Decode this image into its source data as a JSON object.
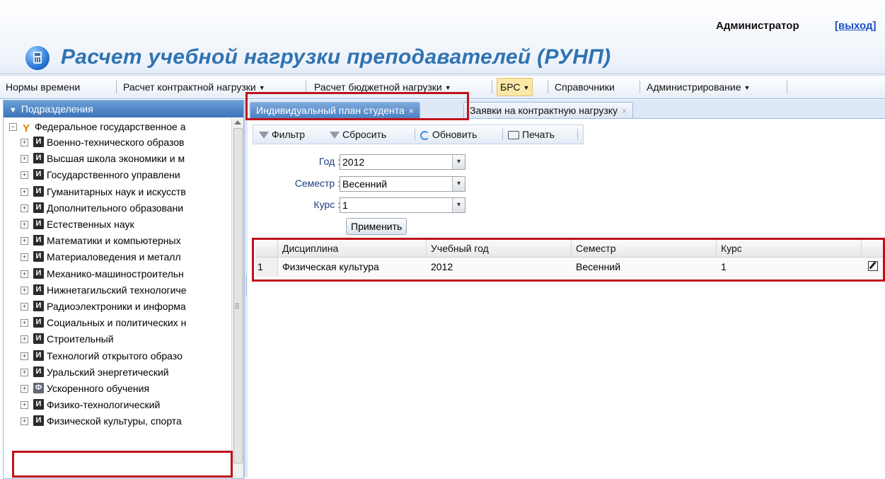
{
  "header": {
    "title": "Расчет учебной нагрузки преподавателей (РУНП)",
    "user": "Администратор",
    "logout": "[выход]"
  },
  "menu": [
    {
      "label": "Нормы времени",
      "has_dropdown": false,
      "active": false
    },
    {
      "label": "Расчет контрактной нагрузки",
      "has_dropdown": true,
      "active": false
    },
    {
      "label": "Расчет бюджетной нагрузки",
      "has_dropdown": true,
      "active": false
    },
    {
      "label": "БРС",
      "has_dropdown": true,
      "active": true
    },
    {
      "label": "Справочники",
      "has_dropdown": false,
      "active": false
    },
    {
      "label": "Администрирование",
      "has_dropdown": true,
      "active": false
    }
  ],
  "left_panel": {
    "title": "Подразделения",
    "tree": {
      "root": "Федеральное государственное а",
      "items": [
        {
          "icon": "И",
          "label": "Военно-технического образов"
        },
        {
          "icon": "И",
          "label": "Высшая школа экономики и м"
        },
        {
          "icon": "И",
          "label": "Государственного управлени"
        },
        {
          "icon": "И",
          "label": "Гуманитарных наук и искусств"
        },
        {
          "icon": "И",
          "label": "Дополнительного образовани"
        },
        {
          "icon": "И",
          "label": "Естественных наук"
        },
        {
          "icon": "И",
          "label": "Математики и компьютерных"
        },
        {
          "icon": "И",
          "label": "Материаловедения и металл"
        },
        {
          "icon": "И",
          "label": "Механико-машиностроительн"
        },
        {
          "icon": "И",
          "label": "Нижнетагильский технологиче"
        },
        {
          "icon": "И",
          "label": "Радиоэлектроники и информа"
        },
        {
          "icon": "И",
          "label": "Социальных и политических н"
        },
        {
          "icon": "И",
          "label": "Строительный"
        },
        {
          "icon": "И",
          "label": "Технологий открытого образо"
        },
        {
          "icon": "И",
          "label": "Уральский энергетический"
        },
        {
          "icon": "Ф",
          "label": "Ускоренного обучения"
        },
        {
          "icon": "И",
          "label": "Физико-технологический"
        },
        {
          "icon": "И",
          "label": "Физической культуры, спорта"
        }
      ]
    }
  },
  "tabs": [
    {
      "label": "Индивидуальный план студента",
      "close": "×",
      "active": true
    },
    {
      "label": "Заявки на контрактную нагрузку",
      "close": "×",
      "active": false
    }
  ],
  "toolbar": {
    "filter": "Фильтр",
    "reset": "Сбросить",
    "refresh": "Обновить",
    "print": "Печать"
  },
  "form": {
    "year_label": "Год :",
    "year_value": "2012",
    "semester_label": "Семестр :",
    "semester_value": "Весенний",
    "course_label": "Курс :",
    "course_value": "1",
    "apply": "Применить"
  },
  "grid": {
    "columns": [
      "Дисциплина",
      "Учебный год",
      "Семестр",
      "Курс"
    ],
    "rows": [
      {
        "num": "1",
        "discipline": "Физическая культура",
        "year": "2012",
        "semester": "Весенний",
        "course": "1"
      }
    ]
  },
  "colors": {
    "accent": "#2f73b3",
    "highlight": "#c0121b",
    "active_menu": "#fbe8a8"
  }
}
